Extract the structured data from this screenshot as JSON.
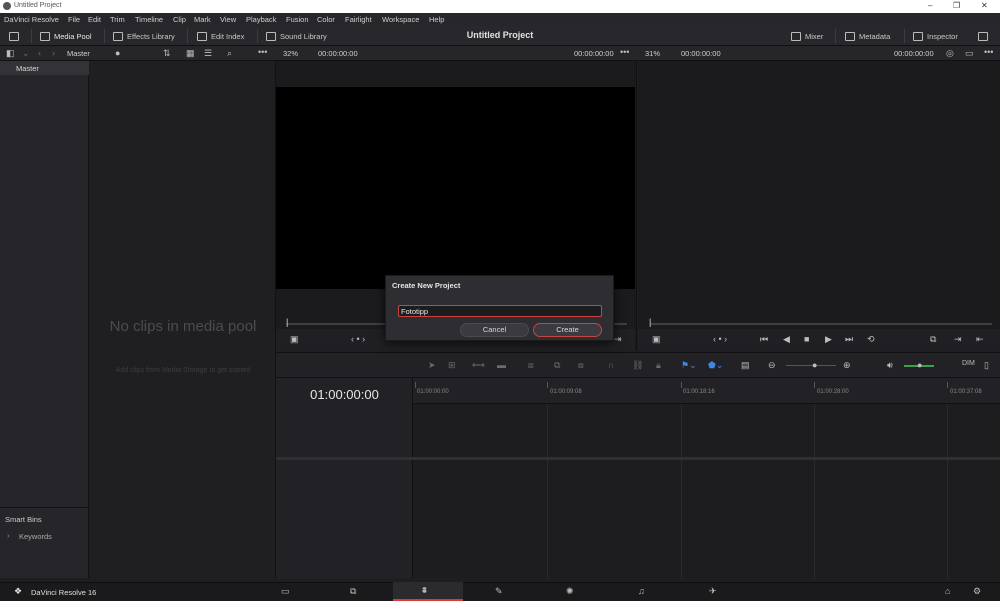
{
  "window": {
    "title": "Untitled Project",
    "controls": [
      "–",
      "❐",
      "✕"
    ]
  },
  "menu": [
    "DaVinci Resolve",
    "File",
    "Edit",
    "Trim",
    "Timeline",
    "Clip",
    "Mark",
    "View",
    "Playback",
    "Fusion",
    "Color",
    "Fairlight",
    "Workspace",
    "Help"
  ],
  "toolbar": {
    "media_pool": "Media Pool",
    "effects_library": "Effects Library",
    "edit_index": "Edit Index",
    "sound_library": "Sound Library",
    "project_title": "Untitled Project",
    "mixer": "Mixer",
    "metadata": "Metadata",
    "inspector": "Inspector"
  },
  "panel": {
    "bin_path": "Master",
    "source_zoom": "32%",
    "source_tc_left": "00:00:00:00",
    "source_tc_right": "00:00:00:00",
    "record_zoom": "31%",
    "record_tc_left": "00:00:00:00",
    "record_tc_right": "00:00:00:00"
  },
  "bins": {
    "master": "Master",
    "smart_bins": "Smart Bins",
    "keywords": "Keywords"
  },
  "media_pool": {
    "empty_title": "No clips in media pool",
    "empty_hint": "Add clips from Media Storage to get started"
  },
  "timeline": {
    "timecode": "01:00:00:00",
    "ruler": [
      "01:00:00:00",
      "01:00:09:08",
      "01:00:18:16",
      "01:00:28:00",
      "01:00:37:08"
    ]
  },
  "dialog": {
    "title": "Create New Project",
    "name_value": "Fototipp",
    "cancel": "Cancel",
    "create": "Create"
  },
  "bottom": {
    "app_name": "DaVinci Resolve 16"
  },
  "colors": {
    "accent_red": "#c8453f",
    "active_page_red": "#d93b3b",
    "bg": "#1e1e21"
  }
}
